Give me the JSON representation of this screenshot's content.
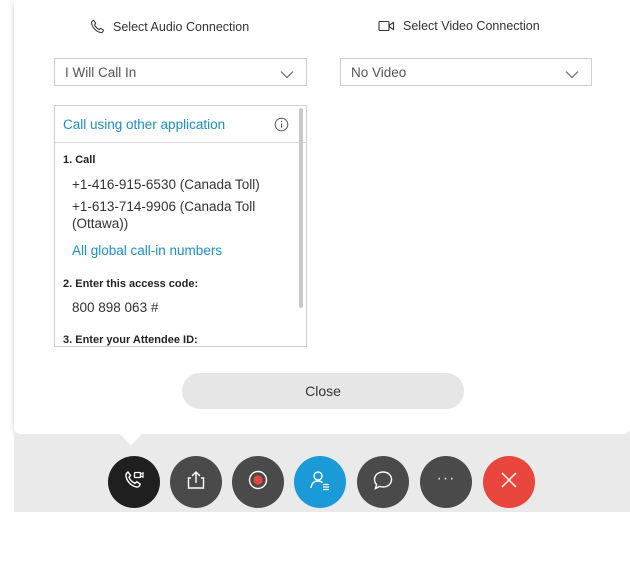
{
  "audio": {
    "header_label": "Select Audio Connection",
    "selected": "I Will Call In"
  },
  "video": {
    "header_label": "Select Video Connection",
    "selected": "No Video"
  },
  "dial_in": {
    "title": "Call using other application",
    "step1_label": "1. Call",
    "number1": "+1-416-915-6530 (Canada Toll)",
    "number2_line1": "+1-613-714-9906 (Canada Toll",
    "number2_line2": "(Ottawa))",
    "global_link": "All global call-in numbers",
    "step2_label": "2. Enter this access code:",
    "access_code": "800 898 063 #",
    "step3_label": "3. Enter your Attendee ID:"
  },
  "close_label": "Close",
  "controls": {
    "more_label": "···",
    "colors": {
      "audio_active": "#1f1f1f",
      "default": "#4a4a4a",
      "participants": "#1a9ad6",
      "leave": "#e8453c"
    },
    "icons": [
      "phone-video-icon",
      "share-icon",
      "record-icon",
      "participants-icon",
      "chat-icon",
      "more-icon",
      "close-x-icon"
    ]
  }
}
